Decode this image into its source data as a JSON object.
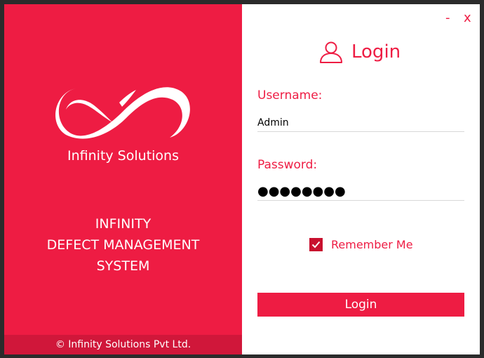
{
  "branding": {
    "company_name": "Infinity Solutions",
    "system_title_lines": [
      "INFINITY",
      "DEFECT MANAGEMENT",
      "SYSTEM"
    ],
    "footer": "© Infinity Solutions Pvt Ltd.",
    "logo_icon": "infinity-logo"
  },
  "window_controls": {
    "minimize": "-",
    "close": "x"
  },
  "login": {
    "title": "Login",
    "icon": "user-icon",
    "username_label": "Username:",
    "username_value": "Admin",
    "password_label": "Password:",
    "password_value": "●●●●●●●●",
    "remember_label": "Remember Me",
    "remember_checked": true,
    "button_label": "Login"
  },
  "colors": {
    "accent": "#ee1c43",
    "footer_bg": "#d0173a",
    "checkbox": "#c8102e"
  }
}
